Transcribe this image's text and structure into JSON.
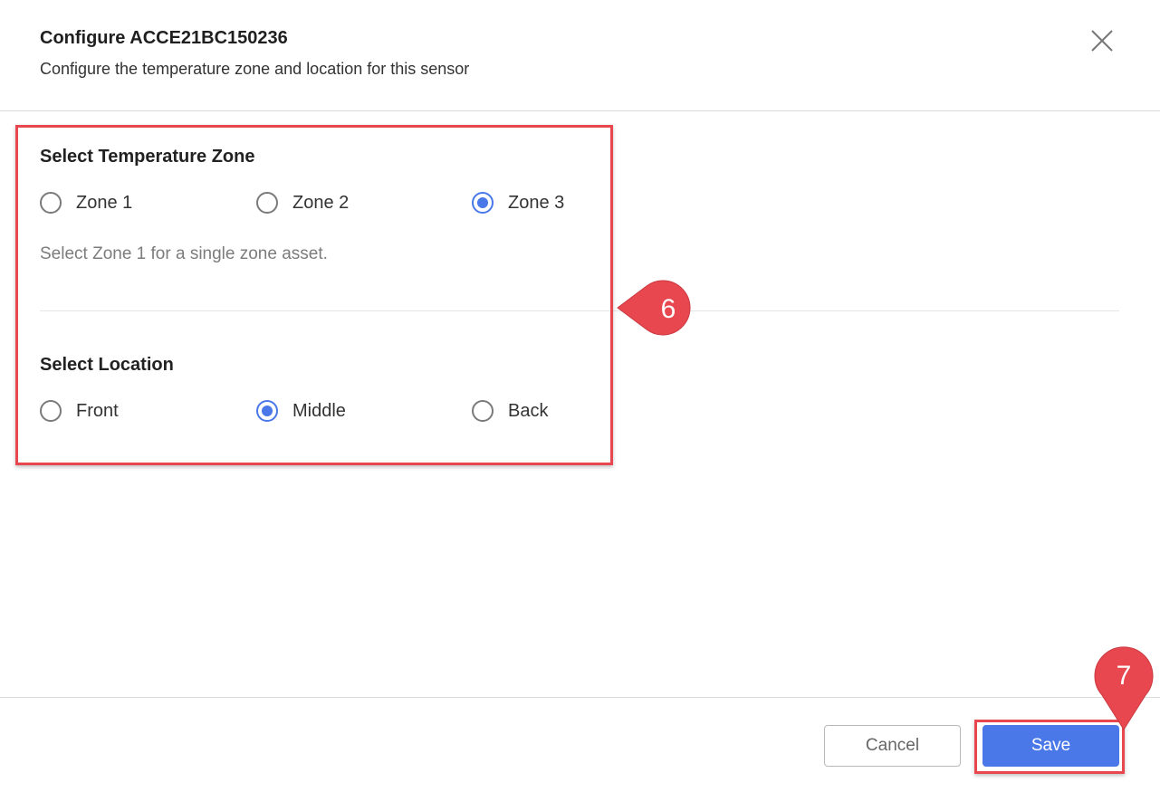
{
  "dialog": {
    "title": "Configure ACCE21BC150236",
    "subtitle": "Configure the temperature zone and location for this sensor",
    "close_icon": "close-icon"
  },
  "zone": {
    "title": "Select Temperature Zone",
    "options": [
      {
        "label": "Zone 1",
        "checked": false
      },
      {
        "label": "Zone 2",
        "checked": false
      },
      {
        "label": "Zone 3",
        "checked": true
      }
    ],
    "helper": "Select Zone 1 for a single zone asset."
  },
  "location": {
    "title": "Select Location",
    "options": [
      {
        "label": "Front",
        "checked": false
      },
      {
        "label": "Middle",
        "checked": true
      },
      {
        "label": "Back",
        "checked": false
      }
    ]
  },
  "footer": {
    "cancel_label": "Cancel",
    "save_label": "Save"
  },
  "annotations": {
    "step6": "6",
    "step7": "7",
    "highlight_color": "#e8474f"
  },
  "colors": {
    "accent": "#4a78e8",
    "radio_border": "#7a7a7a"
  }
}
